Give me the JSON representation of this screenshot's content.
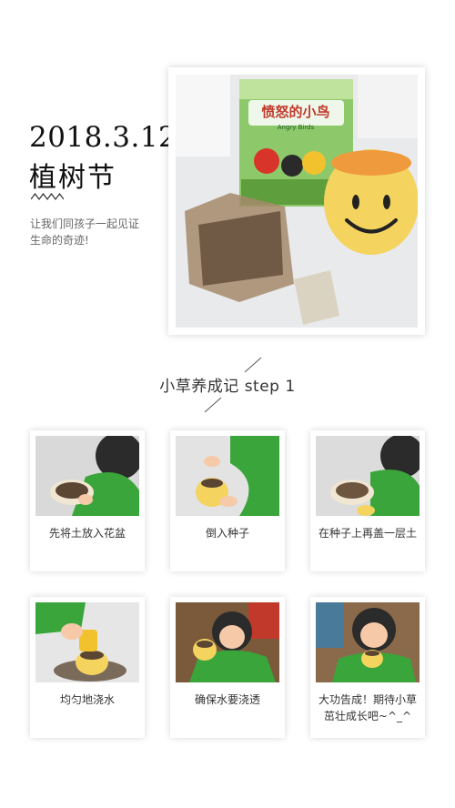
{
  "header": {
    "date": "2018.3.12",
    "title": "植树节",
    "intro": "让我们同孩子一起见证生命的奇迹!"
  },
  "hero": {
    "box_label": "愤怒的小鸟",
    "box_sublabel": "Angry Birds"
  },
  "section": {
    "title": "小草养成记 step 1"
  },
  "steps": [
    {
      "caption": "先将土放入花盆"
    },
    {
      "caption": "倒入种子"
    },
    {
      "caption": "在种子上再盖一层土"
    },
    {
      "caption": "均匀地浇水"
    },
    {
      "caption": "确保水要浇透"
    },
    {
      "caption": "大功告成！期待小草茁壮成长吧~^_^"
    }
  ],
  "colors": {
    "accent_green": "#3aa53a",
    "pot_yellow": "#f4d35e",
    "text_dark": "#111111"
  }
}
